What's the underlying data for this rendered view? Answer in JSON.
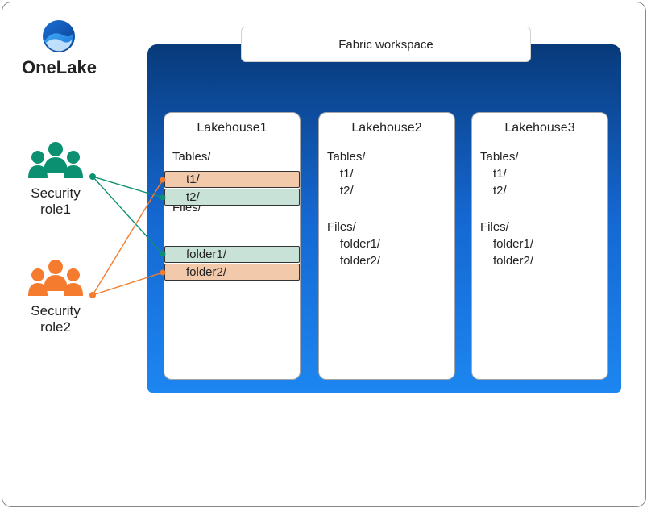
{
  "brand": {
    "name": "OneLake"
  },
  "roles": [
    {
      "id": "role1",
      "label_line1": "Security",
      "label_line2": "role1",
      "color": "#0b9171"
    },
    {
      "id": "role2",
      "label_line1": "Security",
      "label_line2": "role2",
      "color": "#f57c2f"
    }
  ],
  "workspace": {
    "title": "Fabric workspace",
    "lakehouses": [
      {
        "title": "Lakehouse1",
        "tables_label": "Tables/",
        "files_label": "Files/",
        "tables": [
          {
            "name": "t1/",
            "highlight": "orange",
            "role": "role2"
          },
          {
            "name": "t2/",
            "highlight": "teal",
            "role": "role1"
          }
        ],
        "files": [
          {
            "name": "folder1/",
            "highlight": "teal",
            "role": "role1"
          },
          {
            "name": "folder2/",
            "highlight": "orange",
            "role": "role2"
          }
        ]
      },
      {
        "title": "Lakehouse2",
        "tables_label": "Tables/",
        "files_label": "Files/",
        "tables": [
          {
            "name": "t1/"
          },
          {
            "name": "t2/"
          }
        ],
        "files": [
          {
            "name": "folder1/"
          },
          {
            "name": "folder2/"
          }
        ]
      },
      {
        "title": "Lakehouse3",
        "tables_label": "Tables/",
        "files_label": "Files/",
        "tables": [
          {
            "name": "t1/"
          },
          {
            "name": "t2/"
          }
        ],
        "files": [
          {
            "name": "folder1/"
          },
          {
            "name": "folder2/"
          }
        ]
      }
    ]
  },
  "colors": {
    "teal": "#0b9171",
    "orange": "#f57c2f",
    "hl_orange": "#f3c9ab",
    "hl_teal": "#c9e2d8",
    "workspace_top": "#083a7a",
    "workspace_bottom": "#1d86f0"
  }
}
